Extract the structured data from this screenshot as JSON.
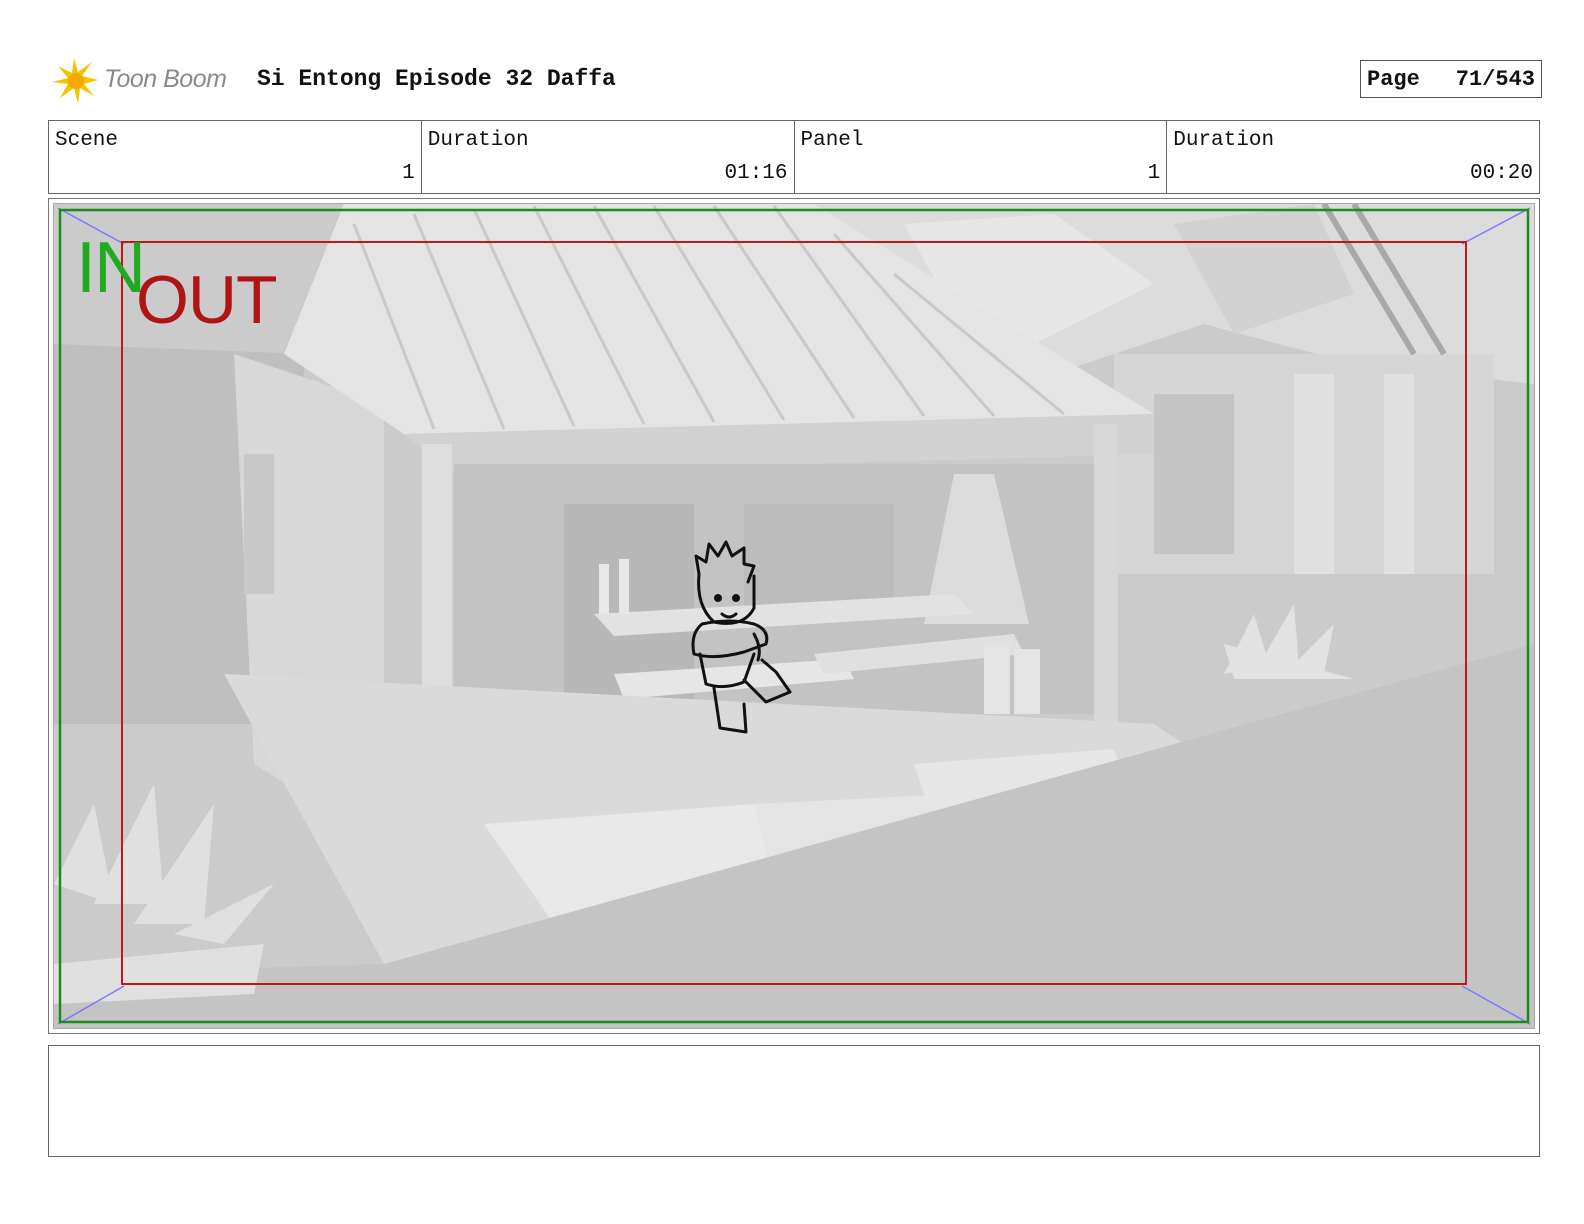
{
  "header": {
    "logo_text": "Toon Boom",
    "title": "Si Entong Episode 32 Daffa",
    "page_label": "Page",
    "page_value": "71/543"
  },
  "info": {
    "scene_label": "Scene",
    "scene_value": "1",
    "scene_duration_label": "Duration",
    "scene_duration_value": "01:16",
    "panel_label": "Panel",
    "panel_value": "1",
    "panel_duration_label": "Duration",
    "panel_duration_value": "00:20"
  },
  "panel": {
    "in_label": "IN",
    "out_label": "OUT",
    "in_color": "#1faa1f",
    "out_color": "#b01414"
  },
  "notes": {
    "text": ""
  }
}
